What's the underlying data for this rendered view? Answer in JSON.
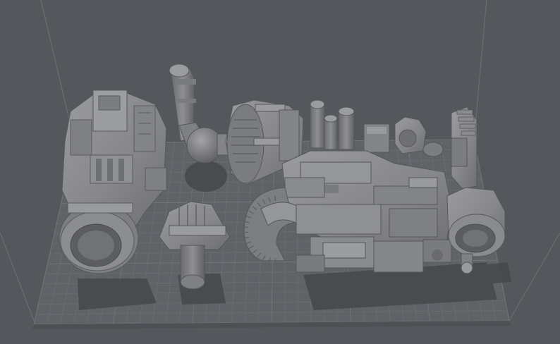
{
  "viewport": {
    "name": "3d-slicer-build-plate-view",
    "background_color": "#54575b",
    "plate_color": "#5f6266",
    "grid_color": "#6e7175",
    "model_color": "#8a8b8d",
    "model_shadow_color": "#3f4245"
  },
  "models": [
    {
      "id": "engine-housing-part"
    },
    {
      "id": "exhaust-pipe-part"
    },
    {
      "id": "turbine-intake-part"
    },
    {
      "id": "piston-cylinders-part"
    },
    {
      "id": "small-clamp-parts"
    },
    {
      "id": "gear-arm-part"
    },
    {
      "id": "bike-chassis-part"
    },
    {
      "id": "wheel-hub-part"
    },
    {
      "id": "ring-mount-part"
    },
    {
      "id": "axle-bracket-part"
    }
  ]
}
